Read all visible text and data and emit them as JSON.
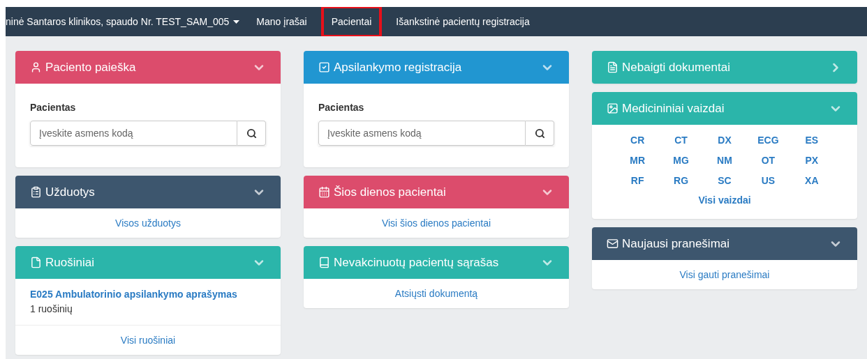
{
  "navbar": {
    "items": [
      {
        "label": "ninė Santaros klinikos, spaudo Nr. TEST_SAM_005",
        "kind": "dropdown",
        "selected": false
      },
      {
        "label": "Mano įrašai",
        "kind": "link",
        "selected": false
      },
      {
        "label": "Pacientai",
        "kind": "link",
        "selected": true
      },
      {
        "label": "Išankstinė pacientų registracija",
        "kind": "link",
        "selected": false
      }
    ]
  },
  "columns": [
    {
      "panels": [
        {
          "kind": "search",
          "title": "Paciento paieška",
          "color": "#dc4c6c",
          "label": "Pacientas",
          "placeholder": "Įveskite asmens kodą"
        },
        {
          "kind": "link",
          "title": "Užduotys",
          "color": "#3d566e",
          "link": "Visos užduotys"
        },
        {
          "kind": "drafts",
          "title": "Ruošiniai",
          "color": "#2bb5aa",
          "item": "E025 Ambulatorinio apsilankymo aprašymas",
          "count": "1 ruošinių",
          "link": "Visi ruošiniai"
        }
      ]
    },
    {
      "panels": [
        {
          "kind": "search",
          "title": "Apsilankymo registracija",
          "color": "#2196d1",
          "label": "Pacientas",
          "placeholder": "Įveskite asmens kodą"
        },
        {
          "kind": "link",
          "title": "Šios dienos pacientai",
          "color": "#dc4c6c",
          "link": "Visi šios dienos pacientai"
        },
        {
          "kind": "link",
          "title": "Nevakcinuotų pacientų sąrašas",
          "color": "#2bb5aa",
          "link": "Atsiųsti dokumentą"
        }
      ]
    },
    {
      "panels": [
        {
          "kind": "header",
          "title": "Nebaigti dokumentai",
          "color": "#2bb5aa"
        },
        {
          "kind": "grid",
          "title": "Medicininiai vaizdai",
          "color": "#2bb5aa",
          "codes": [
            "CR",
            "CT",
            "DX",
            "ECG",
            "ES",
            "MR",
            "MG",
            "NM",
            "OT",
            "PX",
            "RF",
            "RG",
            "SC",
            "US",
            "XA"
          ],
          "link": "Visi vaizdai"
        },
        {
          "kind": "link",
          "title": "Naujausi pranešimai",
          "color": "#3d566e",
          "link": "Visi gauti pranešimai"
        }
      ]
    }
  ]
}
